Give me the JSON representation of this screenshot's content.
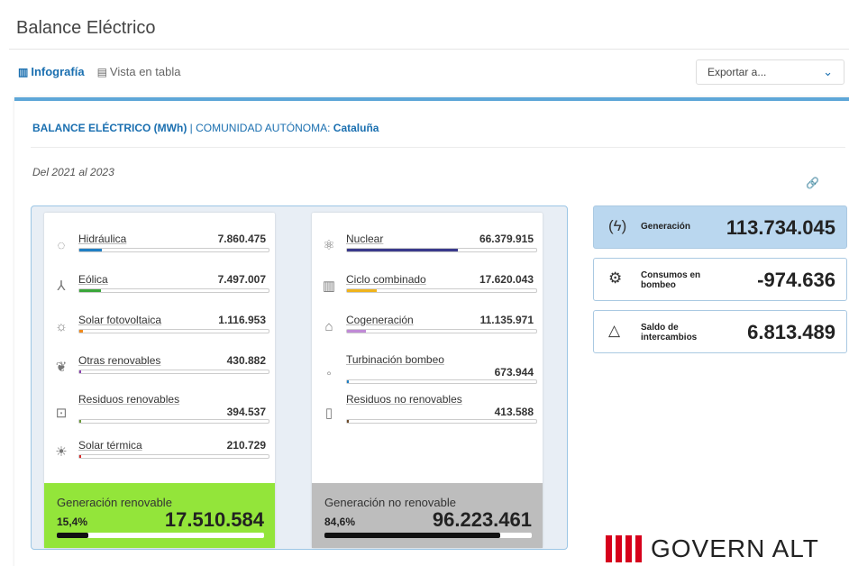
{
  "page": {
    "title": "Balance Eléctrico"
  },
  "tabs": [
    {
      "label": "Infografía",
      "icon": "chart-icon"
    },
    {
      "label": "Vista en tabla",
      "icon": "table-icon"
    }
  ],
  "export": {
    "label": "Exportar a..."
  },
  "header": {
    "title_part1": "BALANCE ELÉCTRICO (MWh)",
    "separator": " | ",
    "title_part2": "COMUNIDAD AUTÓNOMA: ",
    "region": "Cataluña",
    "period": "Del 2021 al 2023"
  },
  "renewable": {
    "items": [
      {
        "label": "Hidráulica",
        "value": "7.860.475",
        "icon": "water-drop-icon",
        "color": "#1f7fc4",
        "fraction": 0.118
      },
      {
        "label": "Eólica",
        "value": "7.497.007",
        "icon": "wind-turbine-icon",
        "color": "#3aa63a",
        "fraction": 0.113
      },
      {
        "label": "Solar fotovoltaica",
        "value": "1.116.953",
        "icon": "solar-panel-icon",
        "color": "#f08a1c",
        "fraction": 0.017
      },
      {
        "label": "Otras renovables",
        "value": "430.882",
        "icon": "leaf-icon",
        "color": "#8a3fb0",
        "fraction": 0.006
      },
      {
        "label": "Residuos renovables",
        "value": "394.537",
        "icon": "recycle-bin-icon",
        "color": "#6a9a3a",
        "fraction": 0.006
      },
      {
        "label": "Solar térmica",
        "value": "210.729",
        "icon": "sun-icon",
        "color": "#d92b2b",
        "fraction": 0.003
      }
    ],
    "summary": {
      "title": "Generación renovable",
      "percent": "15,4%",
      "value": "17.510.584",
      "fraction": 0.154
    }
  },
  "nonrenewable": {
    "items": [
      {
        "label": "Nuclear",
        "value": "66.379.915",
        "icon": "atom-icon",
        "color": "#3a3a8c",
        "fraction": 0.584
      },
      {
        "label": "Ciclo combinado",
        "value": "17.620.043",
        "icon": "power-plant-icon",
        "color": "#f0b41c",
        "fraction": 0.155
      },
      {
        "label": "Cogeneración",
        "value": "11.135.971",
        "icon": "factory-icon",
        "color": "#c08ad6",
        "fraction": 0.098
      },
      {
        "label": "Turbinación bombeo",
        "value": "673.944",
        "icon": "pump-icon",
        "color": "#1f7fc4",
        "fraction": 0.006
      },
      {
        "label": "Residuos no renovables",
        "value": "413.588",
        "icon": "waste-bin-icon",
        "color": "#6d4b2a",
        "fraction": 0.004
      }
    ],
    "summary": {
      "title": "Generación no renovable",
      "percent": "84,6%",
      "value": "96.223.461",
      "fraction": 0.846
    }
  },
  "kpis": [
    {
      "label": "Generación",
      "value": "113.734.045",
      "icon": "lightning-icon",
      "active": true
    },
    {
      "label": "Consumos en bombeo",
      "value": "-974.636",
      "icon": "gear-icon",
      "active": false
    },
    {
      "label": "Saldo de intercambios",
      "value": "6.813.489",
      "icon": "exchange-icon",
      "active": false
    }
  ],
  "brand": {
    "text": "GOVERN ALT"
  },
  "colors": {
    "accent": "#1a6fb0",
    "renewable": "#93e53a",
    "nonrenewable": "#bdbdbd",
    "kpi_active": "#bad7ef"
  }
}
